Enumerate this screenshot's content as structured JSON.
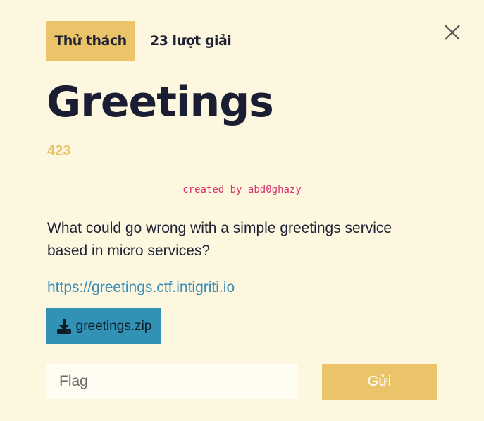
{
  "tabs": {
    "challenge_label": "Thử thách",
    "solves_label": "23 lượt giải"
  },
  "challenge": {
    "title": "Greetings",
    "points": "423",
    "author": "created by abd0ghazy",
    "description": "What could go wrong with a simple greetings service based in micro services?",
    "link": "https://greetings.ctf.intigriti.io",
    "file_name": "greetings.zip"
  },
  "form": {
    "flag_placeholder": "Flag",
    "submit_label": "Gửi"
  },
  "colors": {
    "accent": "#ebc46a",
    "background": "#fdf7df",
    "link": "#3b8db7",
    "file_button": "#3192b6",
    "author": "#d6336c"
  },
  "icons": {
    "close": "close-icon",
    "download": "download-icon"
  }
}
